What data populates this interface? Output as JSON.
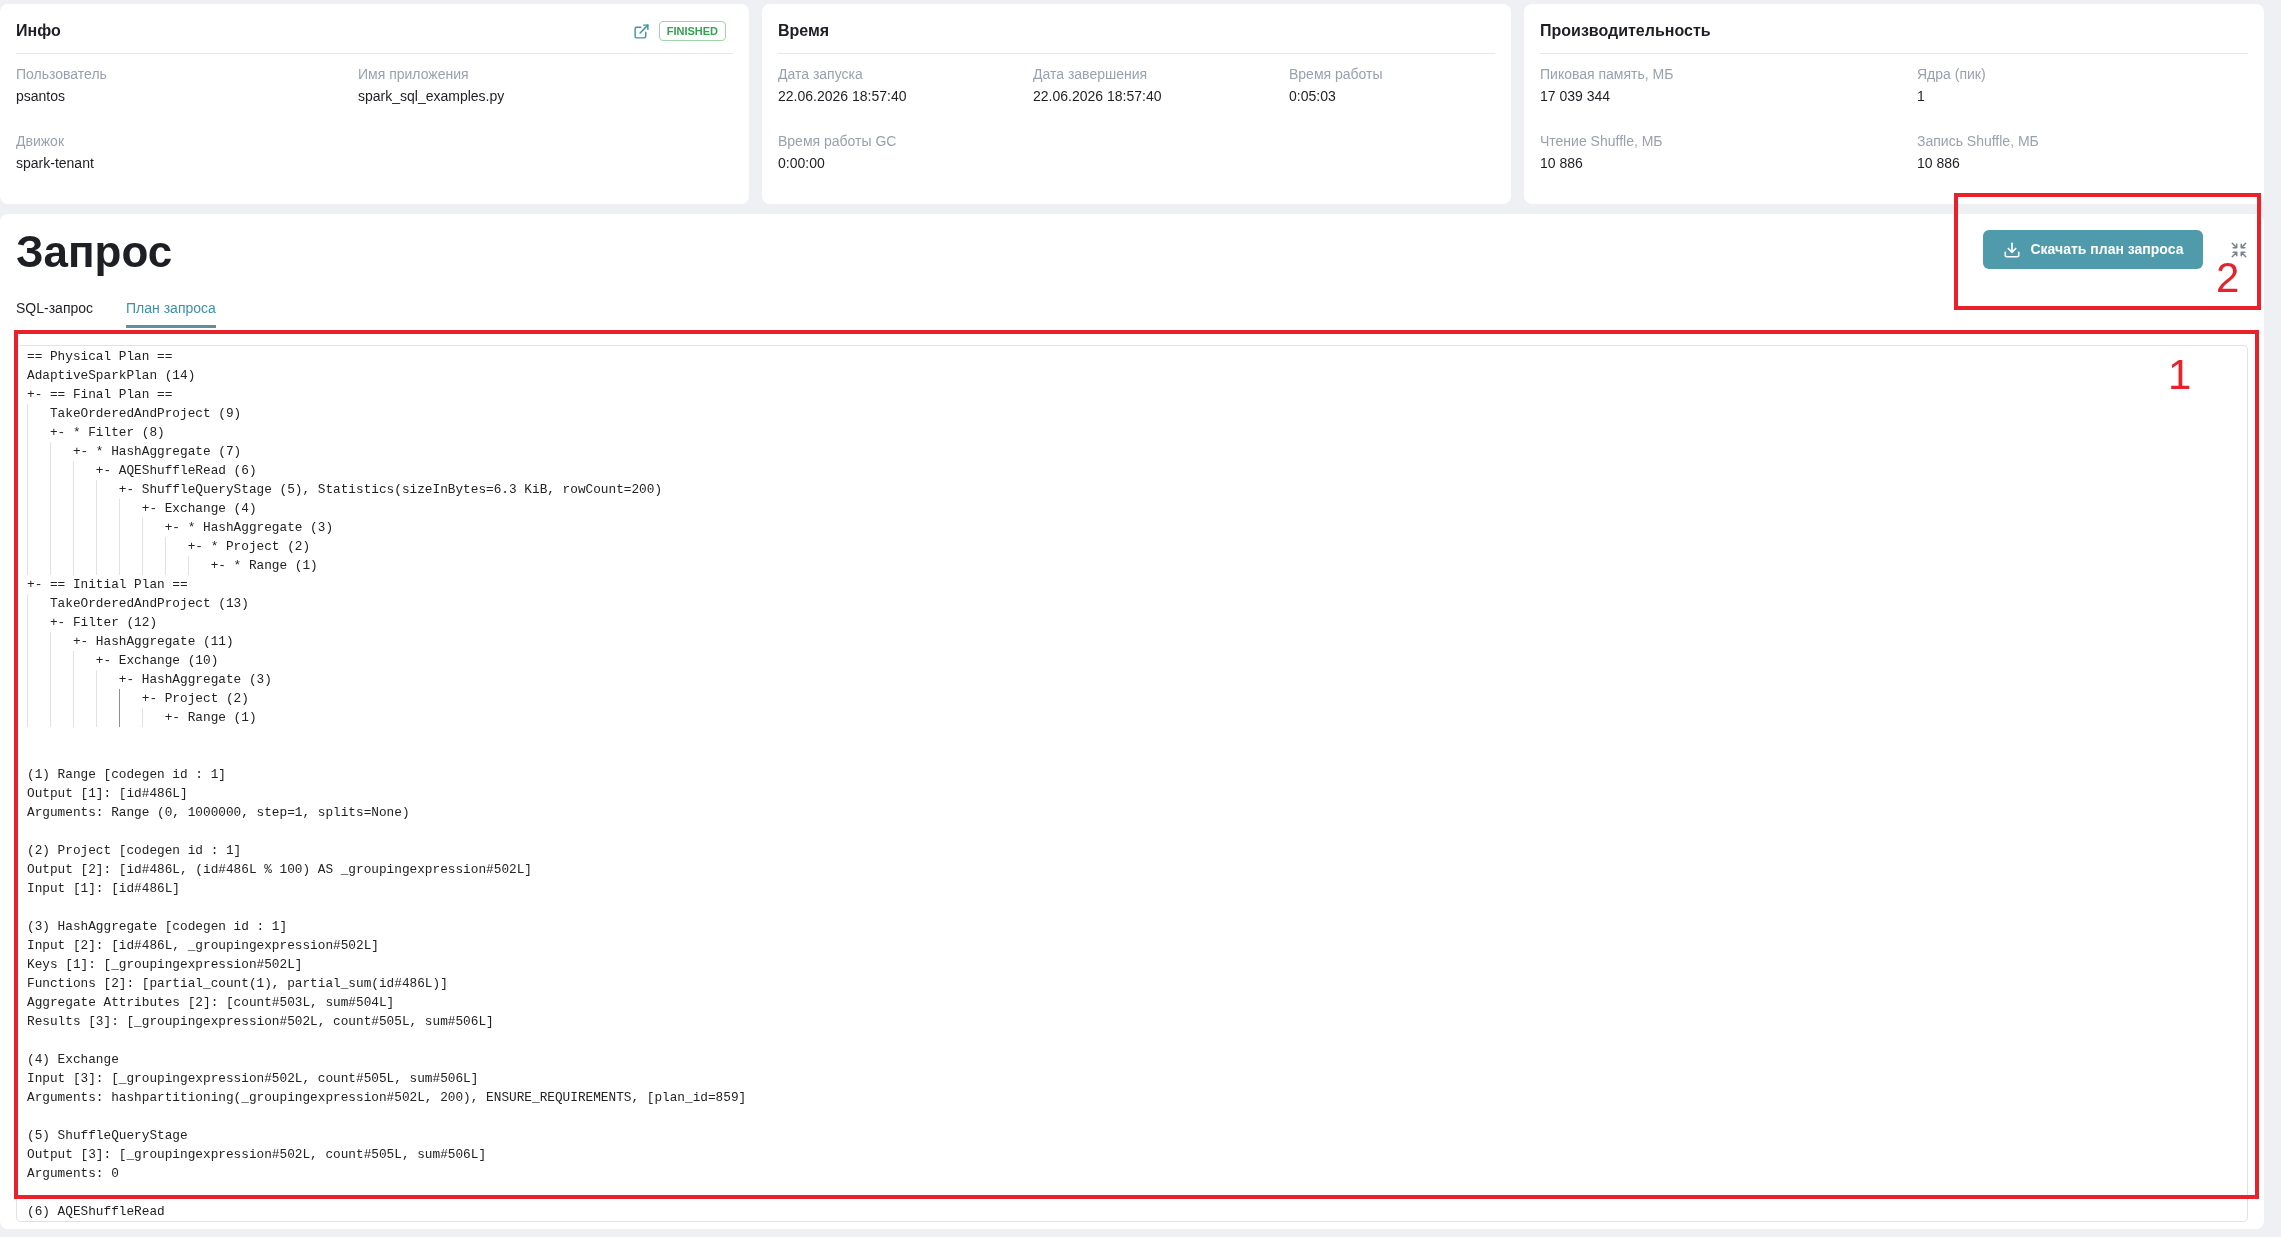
{
  "info_card": {
    "title": "Инфо",
    "status": "FINISHED",
    "fields": [
      {
        "label": "Пользователь",
        "value": "psantos"
      },
      {
        "label": "Имя приложения",
        "value": "spark_sql_examples.py"
      },
      {
        "label": "Движок",
        "value": "spark-tenant"
      }
    ]
  },
  "time_card": {
    "title": "Время",
    "fields": [
      {
        "label": "Дата запуска",
        "value": "22.06.2026 18:57:40"
      },
      {
        "label": "Дата завершения",
        "value": "22.06.2026 18:57:40"
      },
      {
        "label": "Время работы",
        "value": "0:05:03"
      },
      {
        "label": "Время работы GC",
        "value": "0:00:00"
      }
    ]
  },
  "performance_card": {
    "title": "Производительность",
    "fields": [
      {
        "label": "Пиковая память, МБ",
        "value": "17 039 344"
      },
      {
        "label": "Ядра (пик)",
        "value": "1"
      },
      {
        "label": "Чтение Shuffle, МБ",
        "value": "10 886"
      },
      {
        "label": "Запись Shuffle, МБ",
        "value": "10 886"
      }
    ]
  },
  "query": {
    "title": "Запрос",
    "download_button": "Скачать план запроса",
    "tabs": [
      {
        "label": "SQL-запрос",
        "selected": false
      },
      {
        "label": "План запроса",
        "selected": true
      }
    ],
    "plan": {
      "tree": [
        {
          "text": "== Physical Plan =="
        },
        {
          "text": "AdaptiveSparkPlan (14)"
        },
        {
          "text": "+- == Final Plan ==",
          "active_guide": false,
          "children": [
            {
              "text": "TakeOrderedAndProject (9)"
            },
            {
              "text": "+- * Filter (8)",
              "active_guide": false,
              "children": [
                {
                  "text": "+- * HashAggregate (7)",
                  "active_guide": false,
                  "children": [
                    {
                      "text": "+- AQEShuffleRead (6)",
                      "active_guide": false,
                      "children": [
                        {
                          "text": "+- ShuffleQueryStage (5), Statistics(sizeInBytes=6.3 KiB, rowCount=200)",
                          "active_guide": false,
                          "children": [
                            {
                              "text": "+- Exchange (4)",
                              "active_guide": false,
                              "children": [
                                {
                                  "text": "+- * HashAggregate (3)",
                                  "active_guide": false,
                                  "children": [
                                    {
                                      "text": "+- * Project (2)",
                                      "active_guide": false,
                                      "children": [
                                        {
                                          "text": "+- * Range (1)"
                                        }
                                      ]
                                    }
                                  ]
                                }
                              ]
                            }
                          ]
                        }
                      ]
                    }
                  ]
                }
              ]
            }
          ]
        },
        {
          "text": "+- == Initial Plan ==",
          "active_guide": false,
          "children": [
            {
              "text": "TakeOrderedAndProject (13)"
            },
            {
              "text": "+- Filter (12)",
              "active_guide": false,
              "children": [
                {
                  "text": "+- HashAggregate (11)",
                  "active_guide": false,
                  "children": [
                    {
                      "text": "+- Exchange (10)",
                      "active_guide": false,
                      "children": [
                        {
                          "text": "+- HashAggregate (3)",
                          "active_guide": true,
                          "children": [
                            {
                              "text": "+- Project (2)",
                              "active_guide": false,
                              "children": [
                                {
                                  "text": "+- Range (1)"
                                }
                              ]
                            }
                          ]
                        }
                      ]
                    }
                  ]
                }
              ]
            }
          ]
        }
      ],
      "details": [
        {
          "heading": "(1) Range [codegen id : 1]",
          "lines": [
            "Output [1]: [id#486L]",
            "Arguments: Range (0, 1000000, step=1, splits=None)"
          ]
        },
        {
          "heading": "(2) Project [codegen id : 1]",
          "lines": [
            "Output [2]: [id#486L, (id#486L % 100) AS _groupingexpression#502L]",
            "Input [1]: [id#486L]"
          ]
        },
        {
          "heading": "(3) HashAggregate [codegen id : 1]",
          "lines": [
            "Input [2]: [id#486L, _groupingexpression#502L]",
            "Keys [1]: [_groupingexpression#502L]",
            "Functions [2]: [partial_count(1), partial_sum(id#486L)]",
            "Aggregate Attributes [2]: [count#503L, sum#504L]",
            "Results [3]: [_groupingexpression#502L, count#505L, sum#506L]"
          ]
        },
        {
          "heading": "(4) Exchange",
          "lines": [
            "Input [3]: [_groupingexpression#502L, count#505L, sum#506L]",
            "Arguments: hashpartitioning(_groupingexpression#502L, 200), ENSURE_REQUIREMENTS, [plan_id=859]"
          ]
        },
        {
          "heading": "(5) ShuffleQueryStage",
          "lines": [
            "Output [3]: [_groupingexpression#502L, count#505L, sum#506L]",
            "Arguments: 0"
          ]
        },
        {
          "heading": "(6) AQEShuffleRead"
        }
      ]
    }
  },
  "annotations": [
    {
      "label": "1"
    },
    {
      "label": "2"
    }
  ]
}
